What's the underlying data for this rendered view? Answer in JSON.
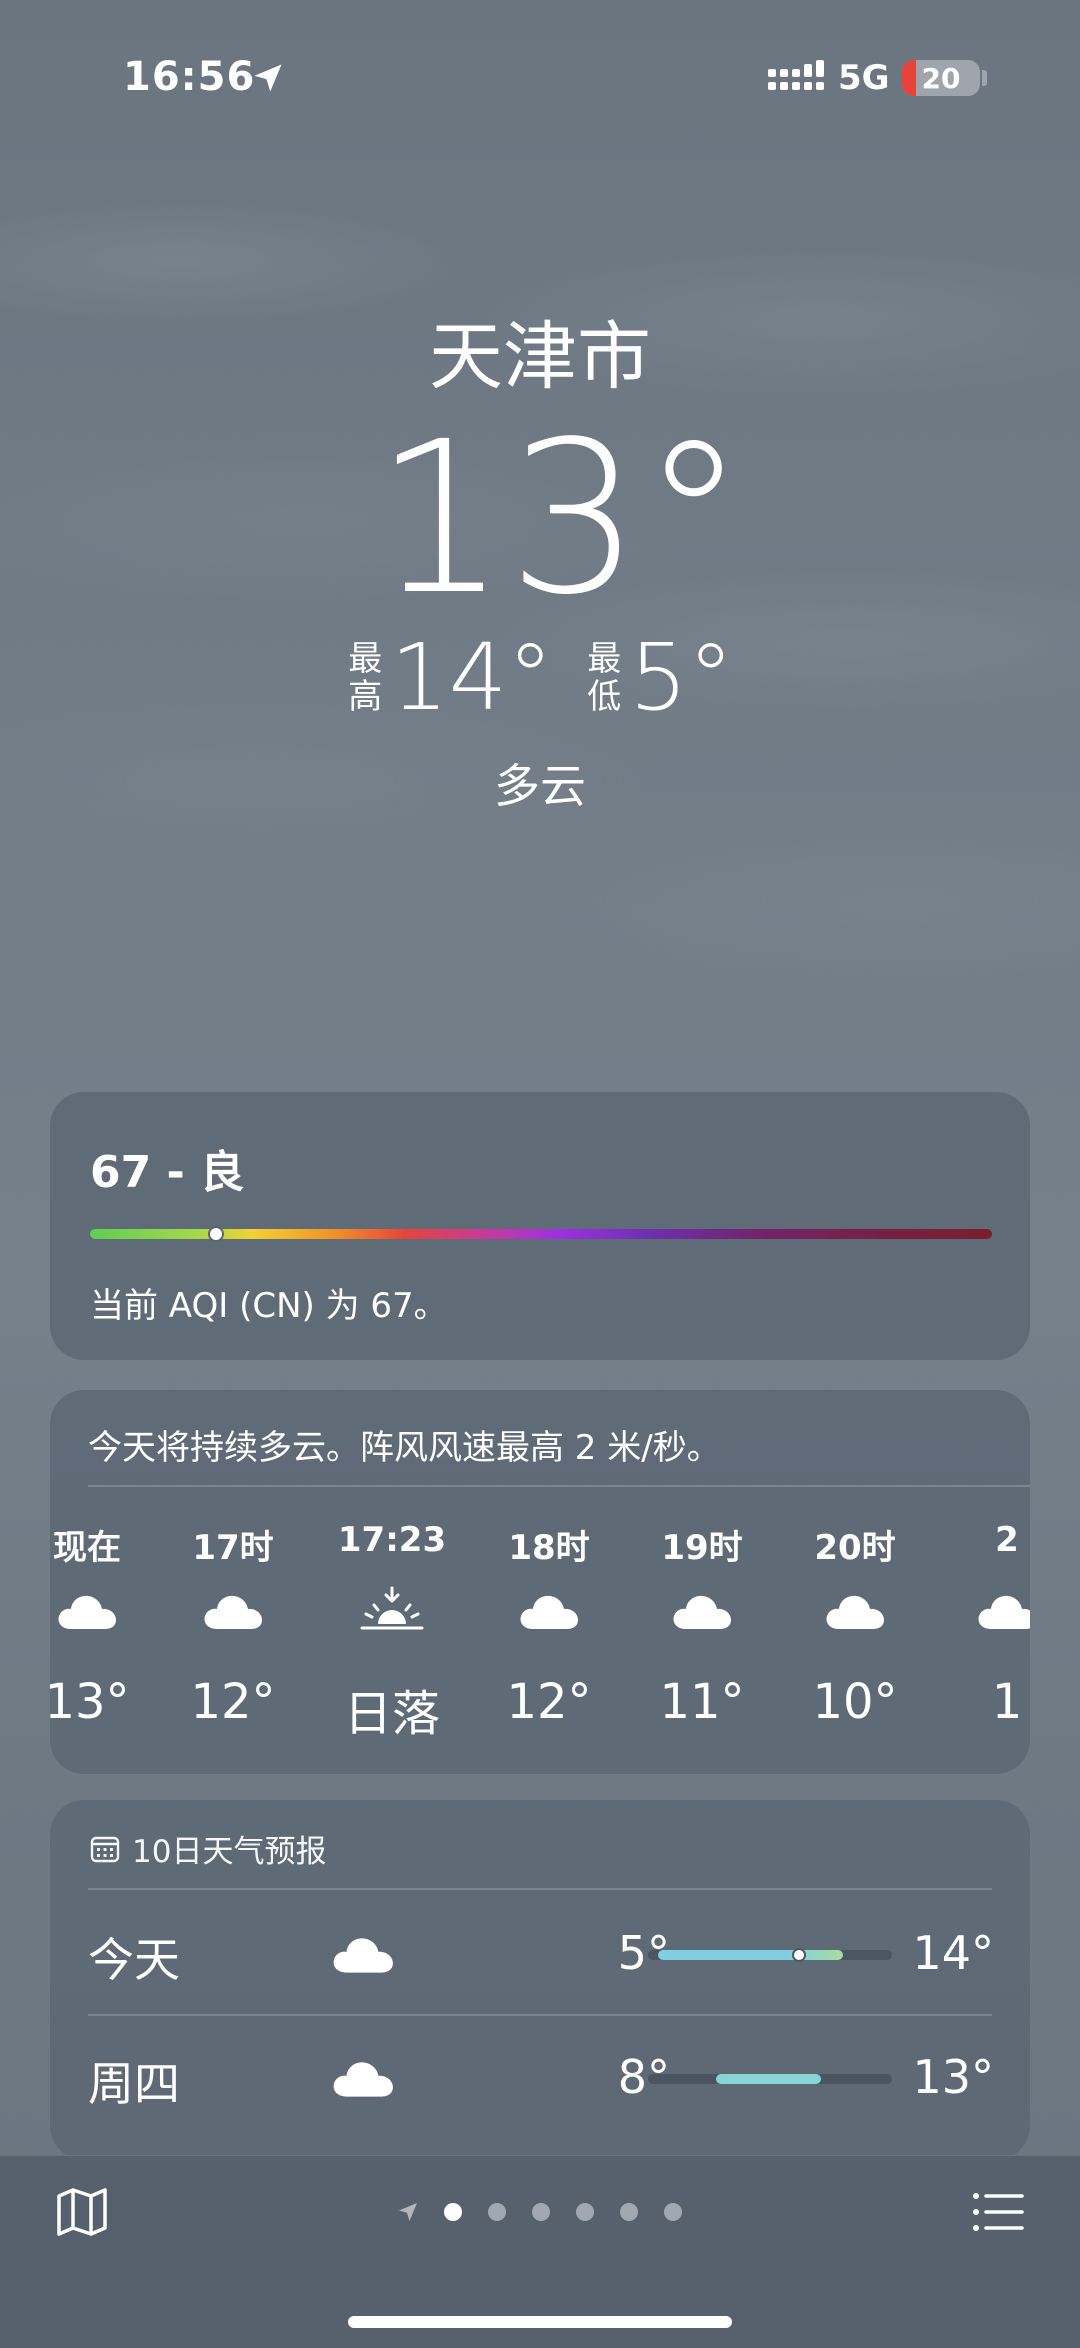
{
  "status_bar": {
    "time": "16:56",
    "network": "5G",
    "battery": "20",
    "icons": [
      "location-arrow-icon",
      "signal-bars-icon",
      "battery-icon"
    ]
  },
  "current": {
    "city": "天津市",
    "temperature": "13°",
    "high_label": "最高",
    "high": "14°",
    "low_label": "最低",
    "low": "5°",
    "condition": "多云"
  },
  "aqi": {
    "title": "67 - 良",
    "description": "当前 AQI (CN) 为 67。",
    "value": 67,
    "indicator_fraction": 0.14
  },
  "hourly": {
    "summary": "今天将持续多云。阵风风速最高 2 米/秒。",
    "items": [
      {
        "time": "现在",
        "icon": "cloud-icon",
        "temp": "13°"
      },
      {
        "time": "17时",
        "icon": "cloud-icon",
        "temp": "12°"
      },
      {
        "time": "17:23",
        "icon": "sunset-icon",
        "temp": "日落"
      },
      {
        "time": "18时",
        "icon": "cloud-icon",
        "temp": "12°"
      },
      {
        "time": "19时",
        "icon": "cloud-icon",
        "temp": "11°"
      },
      {
        "time": "20时",
        "icon": "cloud-icon",
        "temp": "10°"
      },
      {
        "time": "2",
        "icon": "cloud-icon",
        "temp": "1"
      }
    ]
  },
  "ten_day": {
    "title": "10日天气预报",
    "icon": "calendar-icon",
    "days": [
      {
        "day": "今天",
        "icon": "cloud-icon",
        "low": "5°",
        "high": "14°",
        "bar_start": 0.04,
        "bar_end": 0.8,
        "current_fraction": 0.62,
        "colors": [
          "#7fcfe0",
          "#a8dca0"
        ]
      },
      {
        "day": "周四",
        "icon": "cloud-icon",
        "low": "8°",
        "high": "13°",
        "bar_start": 0.28,
        "bar_end": 0.71,
        "current_fraction": null,
        "colors": [
          "#86d6d6",
          "#86d6d6"
        ]
      }
    ]
  },
  "bottom_bar": {
    "page_count": 6,
    "active_page": 0,
    "icons": [
      "map-icon",
      "location-arrow-icon",
      "list-icon"
    ]
  }
}
